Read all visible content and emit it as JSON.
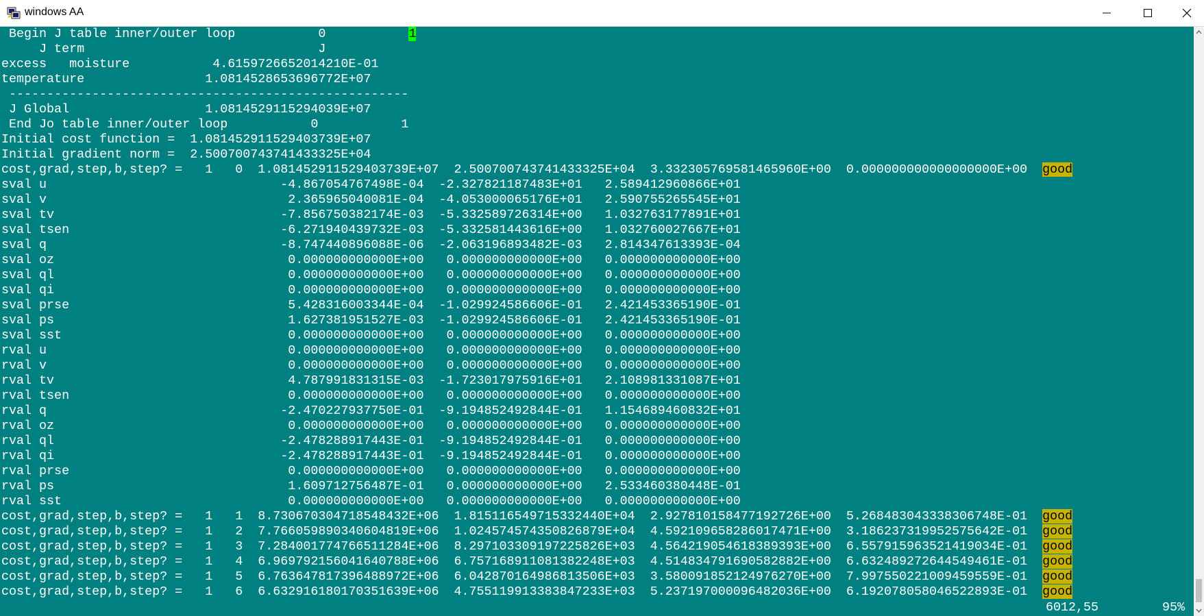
{
  "window": {
    "title": "windows AA",
    "icon": "putty-terminal-icon",
    "controls": [
      "minimize-icon",
      "maximize-icon",
      "close-icon"
    ]
  },
  "terminal": {
    "header": {
      "line1": {
        "text": " Begin J table inner/outer loop           0           ",
        "badge": "1"
      },
      "line2": "     J term                               J",
      "line3": "excess   moisture           4.6159726652014210E-01",
      "line4": "temperature                1.0814528653696772E+07",
      "line5": " -----------------------------------------------------",
      "line6": " J Global                  1.0814529115294039E+07",
      "line7": " End Jo table inner/outer loop           0           1",
      "line8": "Initial cost function =  1.081452911529403739E+07",
      "line9": "Initial gradient norm =  2.500700743741433325E+04"
    },
    "iter0": {
      "text": "cost,grad,step,b,step? =   1   0  1.081452911529403739E+07  2.500700743741433325E+04  3.332305769581465960E+00  0.000000000000000000E+00  ",
      "status": "good"
    },
    "sval_rows": [
      "sval u                               -4.867054767498E-04  -2.327821187483E+01   2.589412960866E+01",
      "sval v                                2.365965040081E-04  -4.053000065176E+01   2.590755265545E+01",
      "sval tv                              -7.856750382174E-03  -5.332589726314E+00   1.032763177891E+01",
      "sval tsen                            -6.271940439732E-03  -5.332581443616E+00   1.032760027667E+01",
      "sval q                               -8.747440896088E-06  -2.063196893482E-03   2.814347613393E-04",
      "sval oz                               0.000000000000E+00   0.000000000000E+00   0.000000000000E+00",
      "sval ql                               0.000000000000E+00   0.000000000000E+00   0.000000000000E+00",
      "sval qi                               0.000000000000E+00   0.000000000000E+00   0.000000000000E+00",
      "sval prse                             5.428316003344E-04  -1.029924586606E-01   2.421453365190E-01",
      "sval ps                               1.627381951527E-03  -1.029924586606E-01   2.421453365190E-01",
      "sval sst                              0.000000000000E+00   0.000000000000E+00   0.000000000000E+00"
    ],
    "rval_rows": [
      "rval u                                0.000000000000E+00   0.000000000000E+00   0.000000000000E+00",
      "rval v                                0.000000000000E+00   0.000000000000E+00   0.000000000000E+00",
      "rval tv                               4.787991831315E-03  -1.723017975916E+01   2.108981331087E+01",
      "rval tsen                             0.000000000000E+00   0.000000000000E+00   0.000000000000E+00",
      "rval q                               -2.470227937750E-01  -9.194852492844E-01   1.154689460832E+01",
      "rval oz                               0.000000000000E+00   0.000000000000E+00   0.000000000000E+00",
      "rval ql                              -2.478288917443E-01  -9.194852492844E-01   0.000000000000E+00",
      "rval qi                              -2.478288917443E-01  -9.194852492844E-01   0.000000000000E+00",
      "rval prse                             0.000000000000E+00   0.000000000000E+00   0.000000000000E+00",
      "rval ps                               1.609712756487E-01   0.000000000000E+00   2.533460380448E-01",
      "rval sst                              0.000000000000E+00   0.000000000000E+00   0.000000000000E+00"
    ],
    "iter_rows": [
      {
        "text": "cost,grad,step,b,step? =   1   1  8.730670304718548432E+06  1.815116549715332440E+04  2.927810158477192726E+00  5.268483043338306748E-01  ",
        "status": "good"
      },
      {
        "text": "cost,grad,step,b,step? =   1   2  7.766059890340604819E+06  1.024574574350826879E+04  4.592109658286017471E+00  3.186237319952575642E-01  ",
        "status": "good"
      },
      {
        "text": "cost,grad,step,b,step? =   1   3  7.284001774766511284E+06  8.297103309197225826E+03  4.564219054618389393E+00  6.557915963521419034E-01  ",
        "status": "good"
      },
      {
        "text": "cost,grad,step,b,step? =   1   4  6.969792156041640788E+06  6.757168911081382248E+03  4.514834791690582882E+00  6.632489272644549461E-01  ",
        "status": "good"
      },
      {
        "text": "cost,grad,step,b,step? =   1   5  6.763647817396488972E+06  6.042870164986813506E+03  3.580091852124976270E+00  7.997550221009459559E-01  ",
        "status": "good"
      },
      {
        "text": "cost,grad,step,b,step? =   1   6  6.632916180170351639E+06  4.755119913383847233E+03  5.237197000096482036E+00  6.192078058046522893E-01  ",
        "status": "good"
      }
    ],
    "status": {
      "position": "6012,55",
      "percent": "95%"
    }
  },
  "colors": {
    "background": "#008080",
    "text": "#ffffff",
    "cursor_highlight": "#00ff00",
    "good_highlight": "#c8b400"
  }
}
